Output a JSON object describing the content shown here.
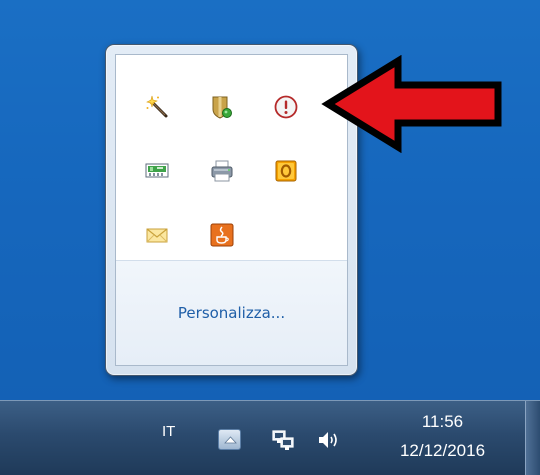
{
  "flyout": {
    "customize_label": "Personalizza...",
    "icons": [
      {
        "name": "magic-wand-icon"
      },
      {
        "name": "shield-update-icon"
      },
      {
        "name": "warning-circle-icon"
      },
      {
        "name": "network-card-icon"
      },
      {
        "name": "printer-icon"
      },
      {
        "name": "outlook-icon"
      },
      {
        "name": "mail-envelope-icon"
      },
      {
        "name": "java-icon"
      }
    ]
  },
  "annotation": {
    "arrow_color": "#e3141b",
    "outline_color": "#000000"
  },
  "taskbar": {
    "language": "IT",
    "time": "11:56",
    "date": "12/12/2016",
    "icons": [
      "show-hidden-icons-icon",
      "network-icon",
      "volume-icon"
    ]
  },
  "colors": {
    "desktop": "#1667bd",
    "taskbar": "#2b4a6e",
    "link": "#1f5fa8"
  }
}
